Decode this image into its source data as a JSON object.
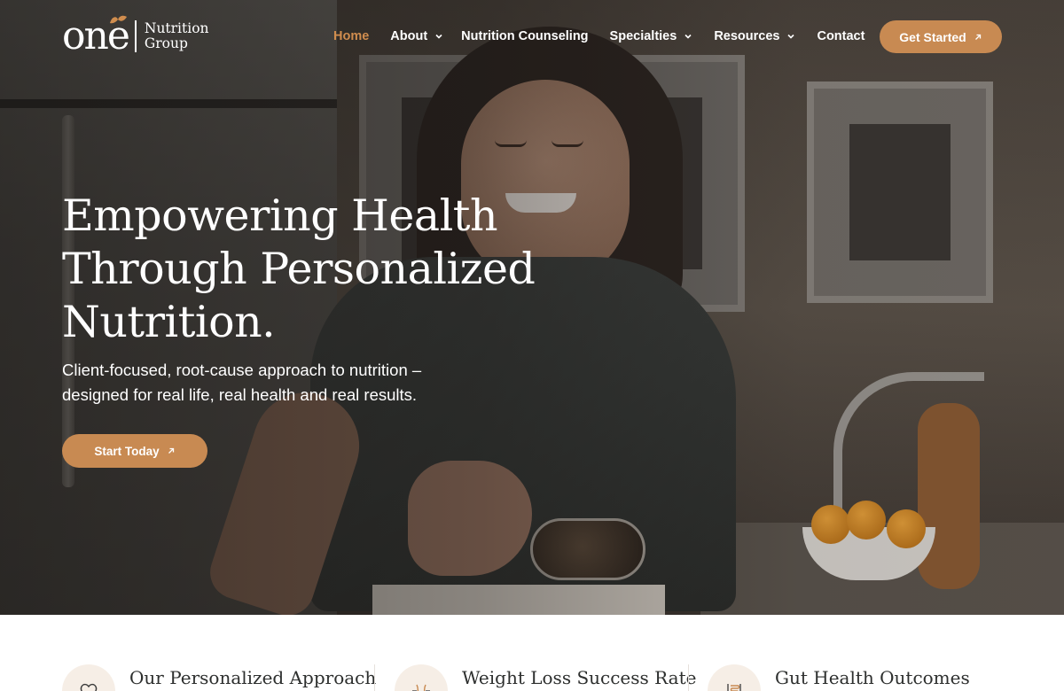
{
  "brand": {
    "logo_main": "one",
    "logo_sub_line1": "Nutrition",
    "logo_sub_line2": "Group",
    "accent_color": "#c88a52"
  },
  "nav": {
    "items": [
      {
        "label": "Home",
        "active": true,
        "has_dropdown": false
      },
      {
        "label": "About",
        "active": false,
        "has_dropdown": true
      },
      {
        "label": "Nutrition Counseling",
        "active": false,
        "has_dropdown": false
      },
      {
        "label": "Specialties",
        "active": false,
        "has_dropdown": true
      },
      {
        "label": "Resources",
        "active": false,
        "has_dropdown": true
      },
      {
        "label": "Contact",
        "active": false,
        "has_dropdown": false
      }
    ],
    "cta_label": "Get Started",
    "cta_icon": "arrow-up-right-icon"
  },
  "hero": {
    "title_line1": "Empowering Health",
    "title_line2": "Through Personalized",
    "title_line3": "Nutrition.",
    "subtitle_line1": "Client-focused, root-cause approach to nutrition –",
    "subtitle_line2": "designed for real life, real health and real results.",
    "cta_label": "Start Today",
    "cta_icon": "arrow-up-right-icon"
  },
  "features": [
    {
      "title": "Our Personalized Approach",
      "icon": "heart-icon"
    },
    {
      "title": "Weight Loss Success Rate",
      "icon": "waist-measure-icon"
    },
    {
      "title": "Gut Health Outcomes",
      "icon": "gut-icon"
    }
  ]
}
